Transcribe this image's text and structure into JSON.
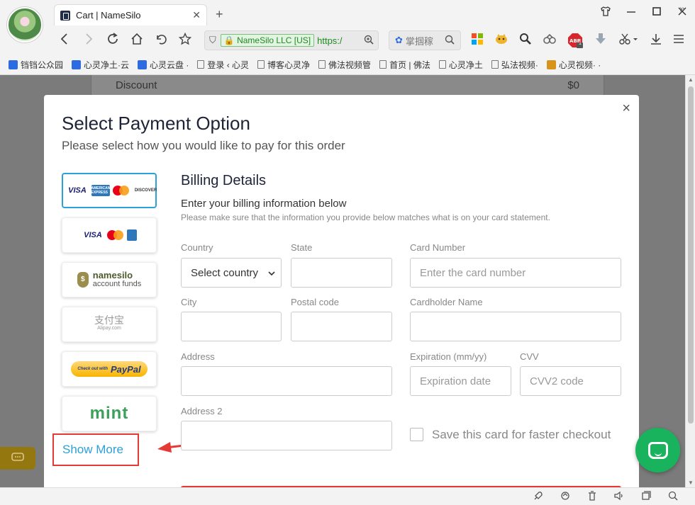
{
  "browser": {
    "tab_title": "Cart | NameSilo",
    "tab_close": "✕",
    "new_tab": "+",
    "ssl_label": "NameSilo LLC [US]",
    "url_prefix": "https:/",
    "search_text": "掌掴稼",
    "bookmarks": [
      {
        "label": "铛铛公众园",
        "color": "#2d6be0"
      },
      {
        "label": "心灵净土·云",
        "color": "#2d6be0"
      },
      {
        "label": "心灵云盘 ·",
        "color": "#2d6be0"
      },
      {
        "label": "登录 ‹ 心灵",
        "color": ""
      },
      {
        "label": "博客心灵净",
        "color": ""
      },
      {
        "label": "佛法视频管",
        "color": ""
      },
      {
        "label": "首页 | 佛法",
        "color": ""
      },
      {
        "label": "心灵净土",
        "color": ""
      },
      {
        "label": "弘法视频·",
        "color": ""
      },
      {
        "label": "心灵视频· ·",
        "color": "#d8941a"
      }
    ],
    "bookmarks_more": "»",
    "abp_count": "1"
  },
  "background": {
    "discount_label": "Discount",
    "discount_value": "$0"
  },
  "modal": {
    "close": "×",
    "title": "Select Payment Option",
    "subtitle": "Please select how you would like to pay for this order",
    "payment_options": [
      "credit-cards-full",
      "credit-cards-short",
      "namesilo-account-funds",
      "alipay",
      "paypal",
      "mint"
    ],
    "namesilo_line1": "namesilo",
    "namesilo_line2": "account funds",
    "alipay_line1": "支付宝",
    "alipay_line2": "Alipay.com",
    "paypal_small": "Check out with",
    "paypal_text": "PayPal",
    "mint_text": "mint",
    "card_visa": "VISA",
    "card_amex": "AMERICAN EXPRESS",
    "card_discover": "DISCOVER",
    "show_more": "Show More",
    "billing": {
      "title": "Billing Details",
      "subtitle": "Enter your billing information below",
      "note": "Please make sure that the information you provide below matches what is on your card statement.",
      "country_label": "Country",
      "country_value": "Select country",
      "state_label": "State",
      "card_number_label": "Card Number",
      "card_number_placeholder": "Enter the card number",
      "city_label": "City",
      "postal_label": "Postal code",
      "cardholder_label": "Cardholder Name",
      "address_label": "Address",
      "expiration_label": "Expiration (mm/yy)",
      "expiration_placeholder": "Expiration date",
      "cvv_label": "CVV",
      "cvv_placeholder": "CVV2 code",
      "address2_label": "Address 2",
      "save_card_label": "Save this card for faster checkout"
    }
  },
  "colors": {
    "accent": "#2aa1d8",
    "highlight_red": "#e53935",
    "chat_green": "#19b35d"
  }
}
